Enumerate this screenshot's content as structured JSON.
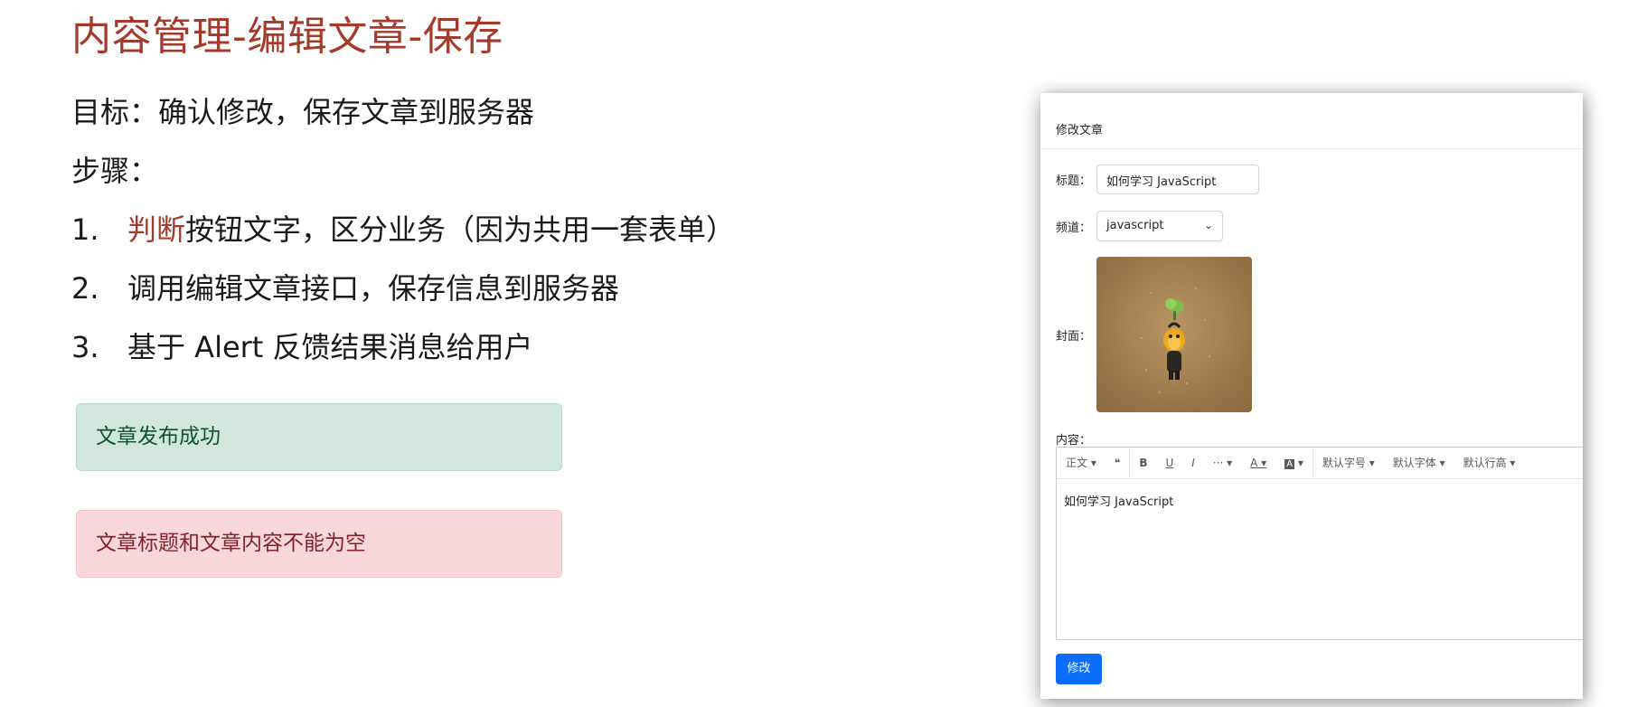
{
  "slide": {
    "title": "内容管理-编辑文章-保存",
    "goal": "目标：确认修改，保存文章到服务器",
    "steps_label": "步骤：",
    "steps": [
      {
        "num": "1.",
        "highlight": "判断",
        "text": "按钮文字，区分业务（因为共用一套表单）"
      },
      {
        "num": "2.",
        "highlight": "",
        "text": "调用编辑文章接口，保存信息到服务器"
      },
      {
        "num": "3.",
        "highlight": "",
        "text": "基于 Alert 反馈结果消息给用户"
      }
    ],
    "alerts": {
      "success": "文章发布成功",
      "danger": "文章标题和文章内容不能为空"
    },
    "accent_color": "#a33a2b"
  },
  "form": {
    "header": "修改文章",
    "title_label": "标题：",
    "title_value": "如何学习 JavaScript",
    "channel_label": "频道：",
    "channel_value": "javascript",
    "cover_label": "封面：",
    "content_label": "内容：",
    "toolbar": {
      "paragraph": "正文",
      "quote": "❝",
      "bold": "B",
      "underline": "U",
      "italic": "I",
      "more": "···",
      "font_color": "A",
      "bg_color": "A",
      "font_size": "默认字号",
      "font_family": "默认字体",
      "line_height": "默认行高"
    },
    "content_value": "如何学习 JavaScript",
    "submit_label": "修改",
    "primary_color": "#0d6efd"
  }
}
